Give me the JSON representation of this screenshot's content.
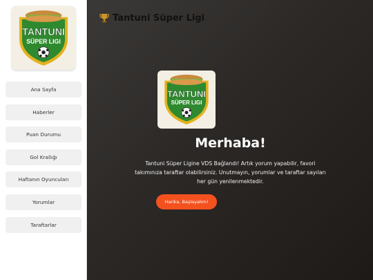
{
  "sidebar": {
    "logo_text": [
      "TANTUNI",
      "SÜPER LIGI"
    ],
    "items": [
      {
        "label": "Ana Sayfa"
      },
      {
        "label": "Haberler"
      },
      {
        "label": "Puan Durumu"
      },
      {
        "label": "Gol Krallığı"
      },
      {
        "label": "Haftanın Oyuncuları"
      },
      {
        "label": "Yorumlar"
      },
      {
        "label": "Taraftarlar"
      }
    ]
  },
  "header": {
    "title": "Tantuni Süper Ligi",
    "icon": "trophy-icon"
  },
  "modal": {
    "greeting": "Merhaba!",
    "message_lines": [
      "Tantuni Süper Ligine VDS Bağlandı! Artık yorum yapabilir, favori",
      "takımınıza taraftar olabilirsiniz. Unutmayın, yorumlar ve taraftar sayıları",
      "her gün yenilenmektedir."
    ],
    "button_label": "Harika, Başlayalım!"
  },
  "colors": {
    "accent": "#f4511e",
    "shield_green": "#2f8a2f",
    "shield_gold": "#e3b21f"
  }
}
